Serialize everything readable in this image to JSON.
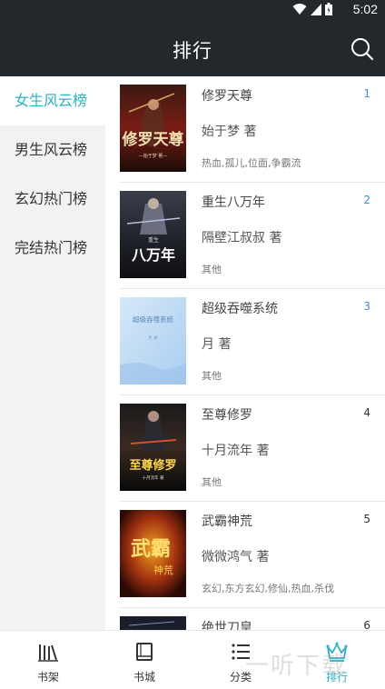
{
  "status_bar": {
    "time": "5:02"
  },
  "header": {
    "title": "排行"
  },
  "sidebar": {
    "items": [
      {
        "label": "女生风云榜",
        "active": true
      },
      {
        "label": "男生风云榜",
        "active": false
      },
      {
        "label": "玄幻热门榜",
        "active": false
      },
      {
        "label": "完结热门榜",
        "active": false
      }
    ]
  },
  "books": [
    {
      "title": "修罗天尊",
      "author": "始于梦 著",
      "tags": "热血,孤儿,位面,争霸流",
      "rank": "1",
      "cover_text": "修罗天尊",
      "cover_sub": "—始于梦 著—"
    },
    {
      "title": "重生八万年",
      "author": "隔壁江叔叔 著",
      "tags": "其他",
      "rank": "2",
      "cover_text": "八万年",
      "cover_sub": "重生"
    },
    {
      "title": "超级吞噬系统",
      "author": "月 著",
      "tags": "其他",
      "rank": "3",
      "cover_text": "超级吞噬系统",
      "cover_sub": "月 著"
    },
    {
      "title": "至尊修罗",
      "author": "十月流年 著",
      "tags": "其他",
      "rank": "4",
      "cover_text": "至尊修罗",
      "cover_sub": "十月流年 著"
    },
    {
      "title": "武霸神荒",
      "author": "微微鸿气 著",
      "tags": "玄幻,东方玄幻,修仙,热血,杀伐",
      "rank": "5",
      "cover_text": "武霸",
      "cover_sub": "神荒"
    },
    {
      "title": "绝世刀皇",
      "author": "",
      "tags": "",
      "rank": "6",
      "cover_text": "",
      "cover_sub": ""
    }
  ],
  "bottom_nav": {
    "items": [
      {
        "label": "书架",
        "icon": "bookshelf-icon"
      },
      {
        "label": "书城",
        "icon": "book-icon"
      },
      {
        "label": "分类",
        "icon": "list-icon"
      },
      {
        "label": "排行",
        "icon": "crown-icon",
        "active": true
      }
    ]
  },
  "watermark": "一听下载",
  "colors": {
    "accent": "#2ab1c4",
    "header_bg": "#23282d",
    "rank_top": "#3a8fd8"
  }
}
